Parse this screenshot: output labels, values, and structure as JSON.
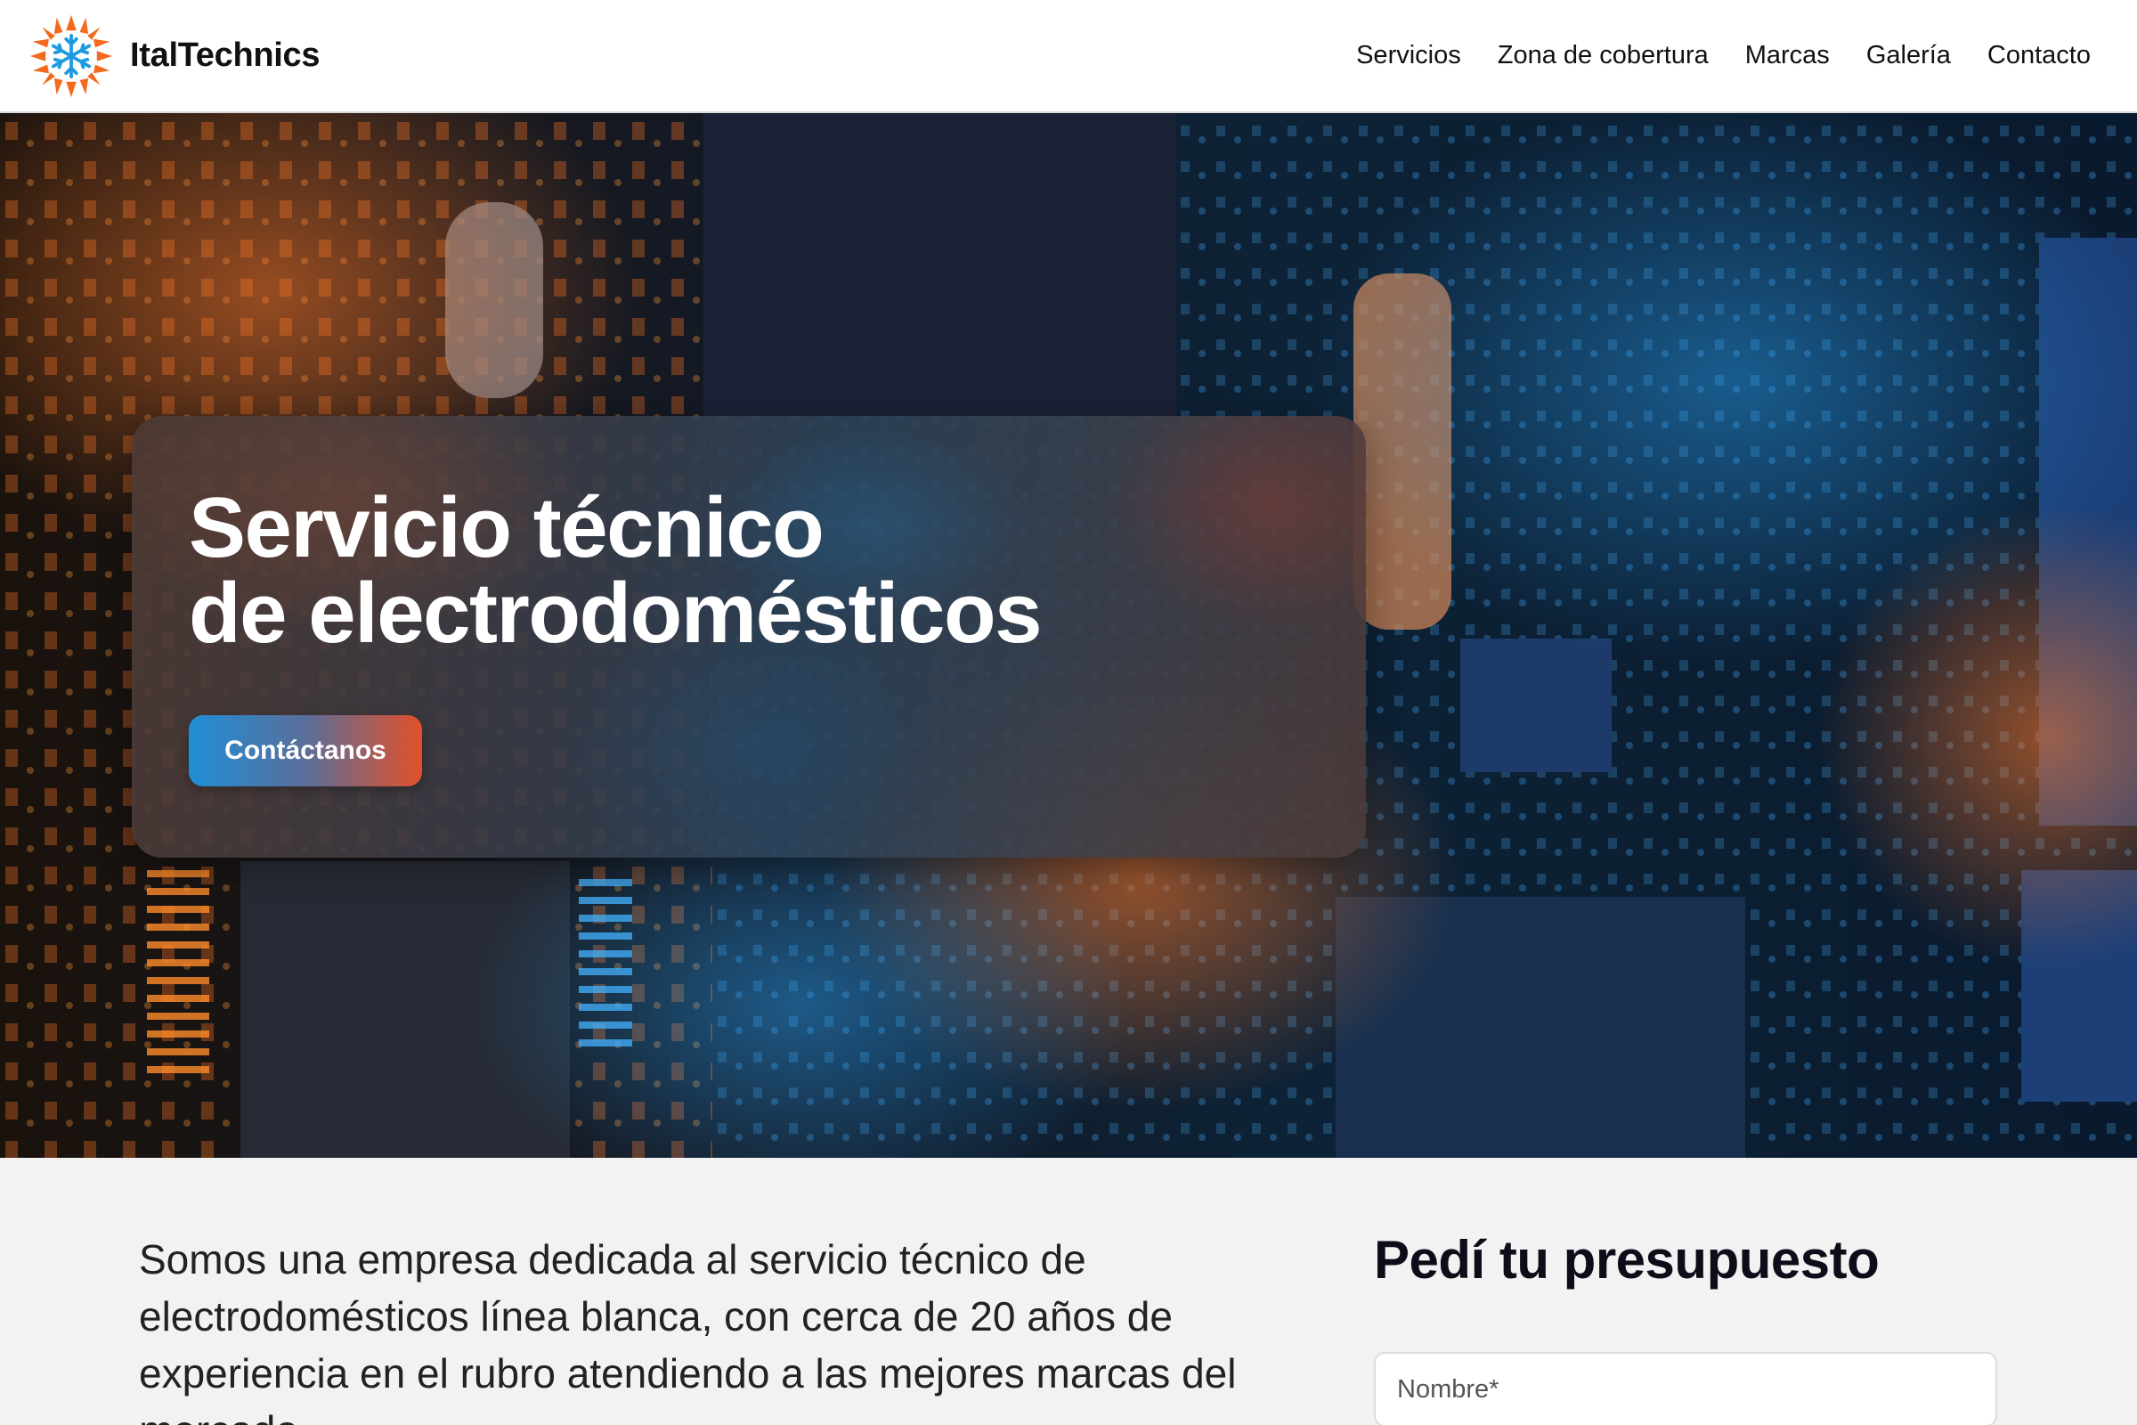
{
  "header": {
    "brand": "ItalTechnics",
    "nav": [
      "Servicios",
      "Zona de cobertura",
      "Marcas",
      "Galería",
      "Contacto"
    ]
  },
  "hero": {
    "title_line1": "Servicio técnico",
    "title_line2": "de electrodomésticos",
    "cta_label": "Contáctanos",
    "background_image": "circuit-board-photo"
  },
  "about": {
    "text": "Somos una empresa dedicada al servicio técnico de electrodomésticos línea blanca, con cerca de 20 años de experiencia en el rubro atendiendo a las mejores marcas del mercado."
  },
  "quote_form": {
    "title": "Pedí tu presupuesto",
    "name_placeholder": "Nombre*"
  },
  "colors": {
    "accent_blue": "#1f8fd6",
    "accent_orange": "#e2502a",
    "content_bg": "#f2f2f2"
  }
}
